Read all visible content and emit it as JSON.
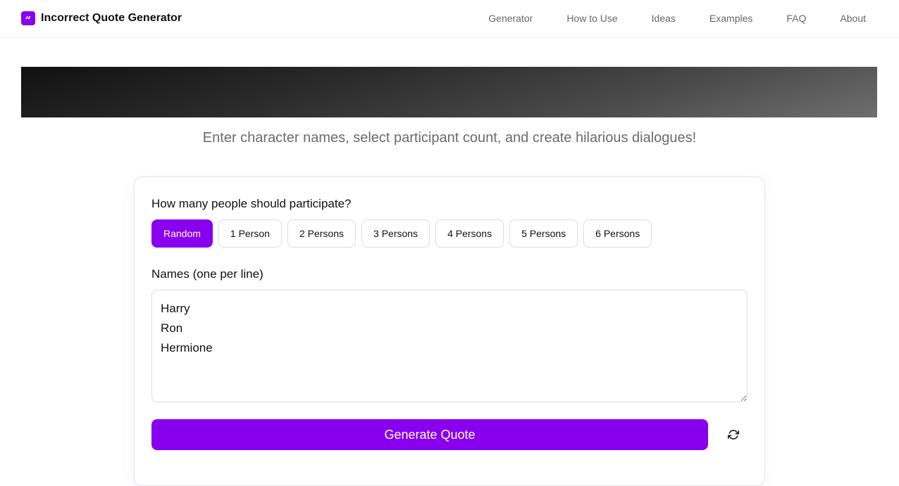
{
  "header": {
    "brand_title": "Incorrect Quote Generator",
    "brand_icon": "quote-icon",
    "nav": [
      {
        "label": "Generator"
      },
      {
        "label": "How to Use"
      },
      {
        "label": "Ideas"
      },
      {
        "label": "Examples"
      },
      {
        "label": "FAQ"
      },
      {
        "label": "About"
      }
    ]
  },
  "hero": {
    "subtitle": "Enter character names, select participant count, and create hilarious dialogues!"
  },
  "form": {
    "count_label": "How many people should participate?",
    "count_options": [
      {
        "label": "Random",
        "selected": true
      },
      {
        "label": "1 Person",
        "selected": false
      },
      {
        "label": "2 Persons",
        "selected": false
      },
      {
        "label": "3 Persons",
        "selected": false
      },
      {
        "label": "4 Persons",
        "selected": false
      },
      {
        "label": "5 Persons",
        "selected": false
      },
      {
        "label": "6 Persons",
        "selected": false
      }
    ],
    "names_label": "Names (one per line)",
    "names_value": "Harry\nRon\nHermione",
    "generate_label": "Generate Quote",
    "refresh_icon": "refresh-icon"
  },
  "colors": {
    "accent": "#8800ee",
    "muted_text": "#6b6b6b",
    "border": "#dddddd"
  }
}
